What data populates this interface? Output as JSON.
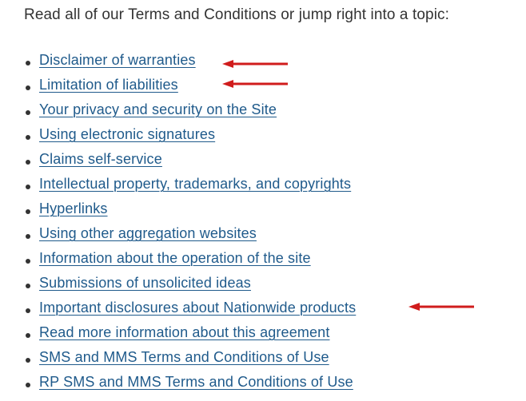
{
  "intro_text": "Read all of our Terms and Conditions or jump right into a topic:",
  "annotation_color": "#d01c1c",
  "link_color": "#1f5a8b",
  "topics": [
    {
      "label": "Disclaimer of warranties",
      "highlighted": true
    },
    {
      "label": "Limitation of liabilities",
      "highlighted": true
    },
    {
      "label": "Your privacy and security on the Site",
      "highlighted": false
    },
    {
      "label": "Using electronic signatures",
      "highlighted": false
    },
    {
      "label": "Claims self-service",
      "highlighted": false
    },
    {
      "label": "Intellectual property, trademarks, and copyrights",
      "highlighted": false
    },
    {
      "label": "Hyperlinks",
      "highlighted": false
    },
    {
      "label": "Using other aggregation websites",
      "highlighted": false
    },
    {
      "label": "Information about the operation of the site",
      "highlighted": false
    },
    {
      "label": "Submissions of unsolicited ideas",
      "highlighted": false
    },
    {
      "label": "Important disclosures about Nationwide products",
      "highlighted": true
    },
    {
      "label": "Read more information about this agreement",
      "highlighted": false
    },
    {
      "label": "SMS and MMS Terms and Conditions of Use",
      "highlighted": false
    },
    {
      "label": "RP SMS and MMS Terms and Conditions of Use",
      "highlighted": false
    }
  ]
}
